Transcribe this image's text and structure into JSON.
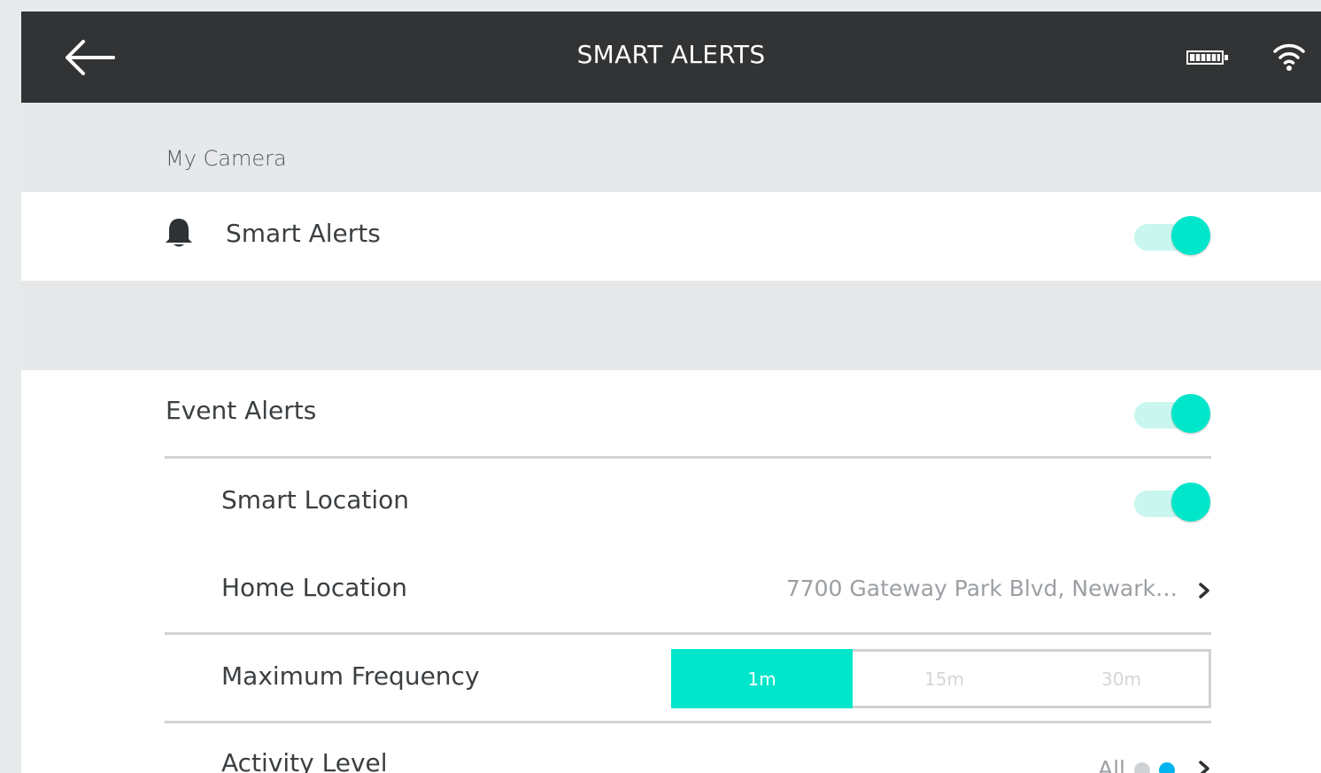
{
  "header": {
    "title": "SMART ALERTS",
    "back_icon": "arrow-left-icon",
    "battery_icon": "battery-icon",
    "wifi_icon": "wifi-icon"
  },
  "section": {
    "label": "My Camera"
  },
  "smart_alerts": {
    "label": "Smart Alerts",
    "icon": "bell-icon",
    "enabled": true
  },
  "event_alerts": {
    "label": "Event Alerts",
    "enabled": true
  },
  "smart_location": {
    "label": "Smart Location",
    "enabled": true
  },
  "home_location": {
    "label": "Home Location",
    "value": "7700 Gateway Park Blvd, Newark…"
  },
  "max_frequency": {
    "label": "Maximum Frequency",
    "options": [
      "1m",
      "15m",
      "30m"
    ],
    "selected": "1m"
  },
  "activity_level": {
    "label": "Activity Level",
    "value": "All"
  },
  "colors": {
    "accent": "#00e6cb",
    "accent_light": "#c9f6ee",
    "header_bg": "#323335",
    "dot_active": "#00b4f0",
    "dot_inactive": "#cfd2d4"
  }
}
